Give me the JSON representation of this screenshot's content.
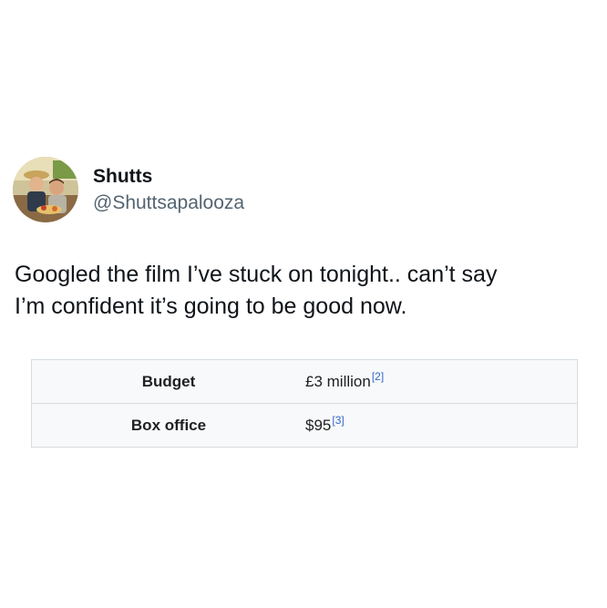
{
  "tweet": {
    "display_name": "Shutts",
    "handle": "@Shuttsapalooza",
    "text_lines": [
      "Googled the film I’ve stuck on tonight.. can’t say",
      "I’m confident it’s going to be good now."
    ]
  },
  "infobox": {
    "rows": [
      {
        "label": "Budget",
        "value": "£3 million",
        "cite": "[2]"
      },
      {
        "label": "Box office",
        "value": "$95",
        "cite": "[3]"
      }
    ]
  },
  "colors": {
    "handle": "#536471",
    "citation_link": "#3366cc",
    "infobox_bg": "#f8f9fa",
    "infobox_border": "#d6dde3"
  }
}
